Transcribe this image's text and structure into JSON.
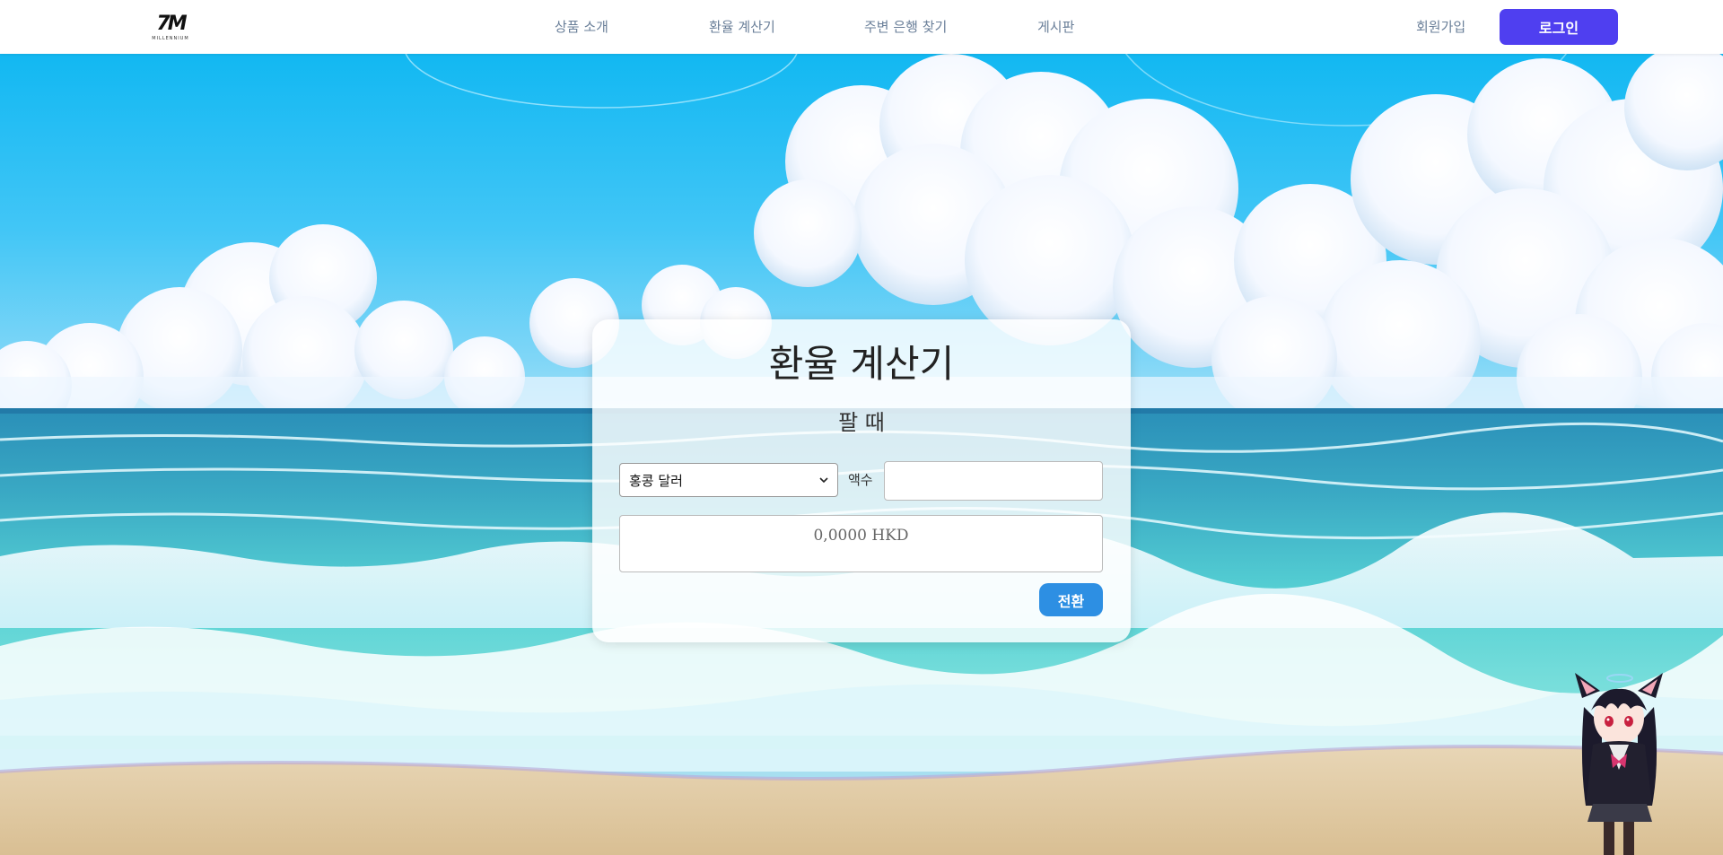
{
  "header": {
    "logo_alt": "MILLENNIUM",
    "nav": [
      {
        "label": "상품 소개"
      },
      {
        "label": "환율 계산기"
      },
      {
        "label": "주변 은행 찾기"
      },
      {
        "label": "게시판"
      }
    ],
    "signup_label": "회원가입",
    "login_label": "로그인"
  },
  "calculator": {
    "title": "환율 계산기",
    "mode": "팔 때",
    "currency_selected": "홍콩 달러",
    "amount_label": "액수",
    "amount_value": "",
    "result": "0,0000 HKD",
    "convert_label": "전환"
  },
  "colors": {
    "accent": "#4f3ff0",
    "convert": "#2d8fe3",
    "nav_text": "#6a7f99"
  }
}
